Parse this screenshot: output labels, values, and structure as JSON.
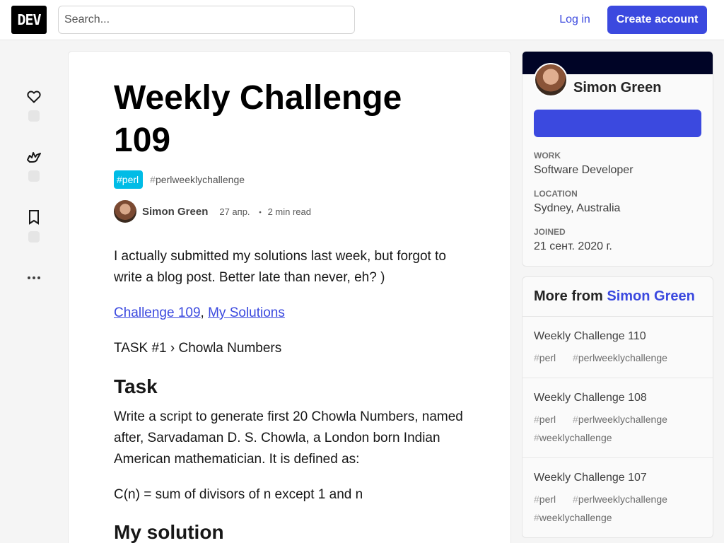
{
  "header": {
    "logo": "DEV",
    "search_placeholder": "Search...",
    "login": "Log in",
    "create_account": "Create account"
  },
  "sidebar_icons": [
    "heart-icon",
    "unicorn-icon",
    "bookmark-icon",
    "more-icon"
  ],
  "article": {
    "title": "Weekly Challenge 109",
    "tags": [
      {
        "hash": "#",
        "label": "perl"
      },
      {
        "hash": "#",
        "label": "perlweeklychallenge"
      }
    ],
    "author": "Simon Green",
    "date": "27 апр.",
    "dot": "・",
    "read_time": "2 min read",
    "intro": "I actually submitted my solutions last week, but forgot to write a blog post. Better late than never, eh? )",
    "link_challenge": "Challenge 109",
    "link_sep": ",",
    "link_solutions": "My Solutions",
    "task1": "TASK #1 › Chowla Numbers",
    "task_heading": "Task",
    "task_text": "Write a script to generate first 20 Chowla Numbers, named after, Sarvadaman D. S. Chowla, a London born Indian American mathematician. It is defined as:",
    "formula": "C(n) = sum of divisors of n except 1 and n",
    "solution_heading": "My solution"
  },
  "author_card": {
    "name": "Simon Green",
    "work_label": "WORK",
    "work": "Software Developer",
    "location_label": "LOCATION",
    "location": "Sydney, Australia",
    "joined_label": "JOINED",
    "joined": "21 сент. 2020 г."
  },
  "more_from": {
    "prefix": "More from",
    "author": "Simon Green",
    "items": [
      {
        "title": "Weekly Challenge 110",
        "tags": [
          "perl",
          "perlweeklychallenge"
        ]
      },
      {
        "title": "Weekly Challenge 108",
        "tags": [
          "perl",
          "perlweeklychallenge",
          "weeklychallenge"
        ]
      },
      {
        "title": "Weekly Challenge 107",
        "tags": [
          "perl",
          "perlweeklychallenge",
          "weeklychallenge"
        ]
      }
    ]
  },
  "colors": {
    "accent": "#3b49df",
    "perl_tag": "#00bce6",
    "banner": "#000426"
  }
}
